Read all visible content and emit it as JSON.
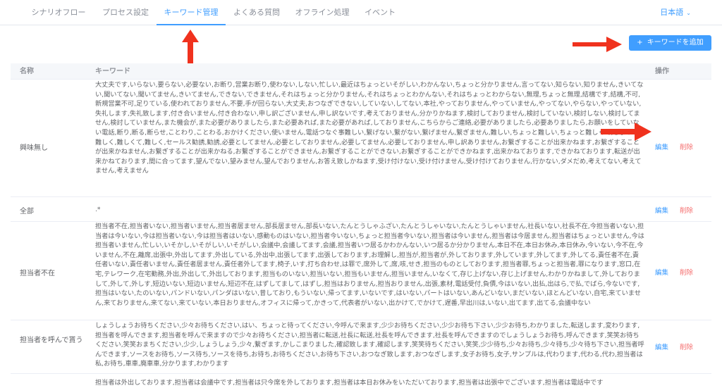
{
  "nav": {
    "tabs": [
      "シナリオフロー",
      "プロセス設定",
      "キーワード管理",
      "よくある質問",
      "オフライン処理",
      "イベント"
    ],
    "active_index": 2,
    "language": "日本語"
  },
  "toolbar": {
    "add_keyword_label": "キーワードを追加",
    "plus_glyph": "+"
  },
  "table": {
    "headers": {
      "name": "名称",
      "keyword": "キーワード",
      "actions": "操作"
    },
    "edit_label": "編集",
    "delete_label": "削除",
    "rows": [
      {
        "name": "興味無し",
        "keywords": "大丈夫です,いらない,要らない,必要ない,お断り,営業お断り,使わない,しない,忙しい,最近はちょっといそがしい,わかんない,ちょっと分かりません,言ってない,知らない,知りません,きいてない,聞いてない,聞いてません,きいてません,できない,できません,それはちょっと分かりません,それはちょっとわかんない,それはちょっとわからない,無理,ちょっと無理,結構です,結構,不可,新規営業不可,足りている,使われておりません,不要,手が回らない,大丈夫,おつなぎできない,していない,してない,本社,やっておりません,やっていません,やってない,やらない,やっていない,失礼します,失礼致します,付き合いません,付き合わない,申し訳ございません,申し訳ないです,考えておりません,分かりかねます,検討しておりません,検討していない,検討しない,検討してません,検討していません,また機会が,また必要がありましたら,また必要あれば,また必要があれば,しておりません,こちらからご連絡,必要がありましたら,必要ありましたら,お願いをしていない電話,断り,断る,断らせ,ことわり,ことわる,おかけください,使いません,電話つなぐ事難しい,繋げない,繋がない,繋げません,繋ぎません,難しい,ちょっと難しい,ちょっと難しくて,ちょっと難しく,難しくて,難しく,セールス勧誘,勧誘,必要としてません,必要としておりません,必要してません,必要しておりません,申し訳ありません,お繋ぎすることが出来かねます,お繋ぎすることが出来かねません,お繋ぎすることが出来かねる,お繋ぎすることができません,お繋ぎすることができない,お繋ぎすることができかねます,出来かねております,できかねております,転送が出来かねております,間に合ってます,望んでない,望みません,望んでおりません,お答え致しかねます,受け付けない,受け付けません,受け付けておりません,行かない,ダメだめ,考えてない,考えてません,考えません"
      },
      {
        "name": "全部",
        "keywords": ".*"
      },
      {
        "name": "担当者不在",
        "keywords": "担当者不在,担当者いない,担当者いません,担当者居ません,部長居ません,部長いない,たんとうしゃふざい,たんとうしゃいない,たんとうしゃいません,社長いない,社長不在,今担当者いない,担当者は今いない,今は担当者いない,今は担当者はいない,感動ものはいない,担当者今いない,ちょっと担当者今いない,担当者は今いません,担当者は今居ません,担当者はちょっといません,今は担当者いません,忙しい,いそかし,いそがしい,いそがしい,会議中,会議してます,会議,担当者いつ居るかわかんない,いつ居るか分かりません,本日不在,本日お休み,本日休み,今いない,今不在,今いません,不在,離席,出張中,外出してます,外出している,外出中,出張してます,出張しております,お理解し,担当が,担当者が,外しております,外しています,外してます,外してる,責任者不在,責任者いない,責任者いません,責任者居ません,責任者外してます,椅子,いす,打ち合わせ,は罪で,席外して,席,咳,せき,担当のものとしております,担当者罪,ちょっと担当者,罪になります,窓口,在宅,テレワーク,在宅勤務,外出,外出して,外出しております,担当ものいない,担当いない,担当もいません,担当いません,いなくて,存じ上げない,存じ上げません,わかりかねまして,外しておりまして,外して,外しす,短边いない,短边いません,短辺不在,はずしてまして,はずし,担当はおりません,担当おりません,出張,素材,電話受付,負債,今はいない,出払,出はら,で払,でばら,今ないです,担当はいない,たのいない,パンドいない,パンダはいない,昔しており,もういない,帰ってます,いないです,はいない,パートはいない,あんどいない,まだいない,ほとんどいない,自宅,来ていません,来ておりません,来てない,来ていない,本日おりません,オフィスに帰って,かきって,代表者がいない,出かけて,でかけて,遅番,早出川は,いない,出てます,出てる,会議中ない"
      },
      {
        "name": "担当者を呼んで貰う",
        "keywords": "しょうしょうお待ちください,少々お待ちください,はい、ちょっと待ってください,今呼んで来ます,少少お待ちください,少少お待ち下さい,少少お待ち,わかりました,転送します,変わります,担当者を呼んできます,担当者を呼んで来ますので少々お待ちください,担当者に転送,社長に転送,社長を呼んできます,社長を呼んできますのでしょうしょうお待ち,呼んできます,笑笑お待ちください,笑笑おまちください,少少,しょうしょう,少々,繋ぎます,かしこまりました,確認致します,確認します,笑笑待ちください,笑笑,少少待ち,少々お待ち,少々待ち,少々待ち下さい,担当者呼んできます,ソースをお待ち,ソース待ち,ソースを待ち,お待ち,お待ちください,お待ち下さい,おつなぎ致します,おつなぎします,女子お待ち,女子,サンプルは,代わります,代わる,代わ,担当者は私,お待ち,車車,廃車車,分かります,わかります"
      },
      {
        "name": "",
        "keywords": "担当者は外出しております,担当者は会議中です,担当者は只今席を外しております,担当者は本日お休みをいただいております,担当者は出張中でございます,担当者は電話中です"
      }
    ]
  }
}
